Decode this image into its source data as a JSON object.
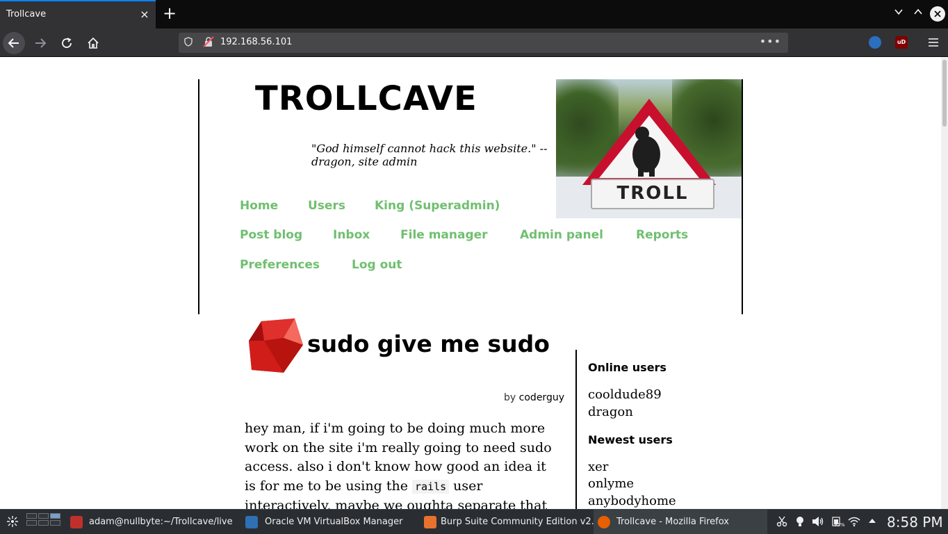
{
  "browser": {
    "tab_title": "Trollcave",
    "tab_close_glyph": "×",
    "new_tab_glyph": "+",
    "url": "192.168.56.101",
    "url_menu_glyph": "•••",
    "ext_ublock_label": "uD"
  },
  "site": {
    "title": "TROLLCAVE",
    "tagline": "\"God himself cannot hack this website.\" -- dragon, site admin",
    "image_label": "TROLL",
    "nav": [
      "Home",
      "Users",
      "King (Superadmin)",
      "Post blog",
      "Inbox",
      "File manager",
      "Admin panel",
      "Reports",
      "Preferences",
      "Log out"
    ],
    "link_color": "#70bf70"
  },
  "post": {
    "title": "sudo give me sudo",
    "by_label": "by",
    "author": "coderguy",
    "body_before": "hey man, if i'm going to be doing much more work on the site i'm really going to need sudo access. also i don't know how good an idea it is for me to be using the ",
    "body_code": "rails",
    "body_after": " user interactively, maybe we oughta separate that"
  },
  "sidebar": {
    "online_heading": "Online users",
    "online_users": [
      "cooldude89",
      "dragon"
    ],
    "newest_heading": "Newest users",
    "newest_users": [
      "xer",
      "onlyme",
      "anybodyhome"
    ]
  },
  "taskbar": {
    "tasks": [
      "adam@nullbyte:~/Trollcave/live",
      "Oracle VM VirtualBox Manager",
      "Burp Suite Community Edition v2...",
      "Trollcave - Mozilla Firefox"
    ],
    "battery": "95%",
    "clock": "8:58 PM"
  },
  "icons": {
    "back": "arrow-left-icon",
    "forward": "arrow-right-icon",
    "reload": "reload-icon",
    "home": "home-icon",
    "shield": "shield-icon",
    "insecure": "insecure-connection-icon",
    "menu": "hamburger-menu-icon",
    "ruby": "ruby-gem-icon"
  }
}
